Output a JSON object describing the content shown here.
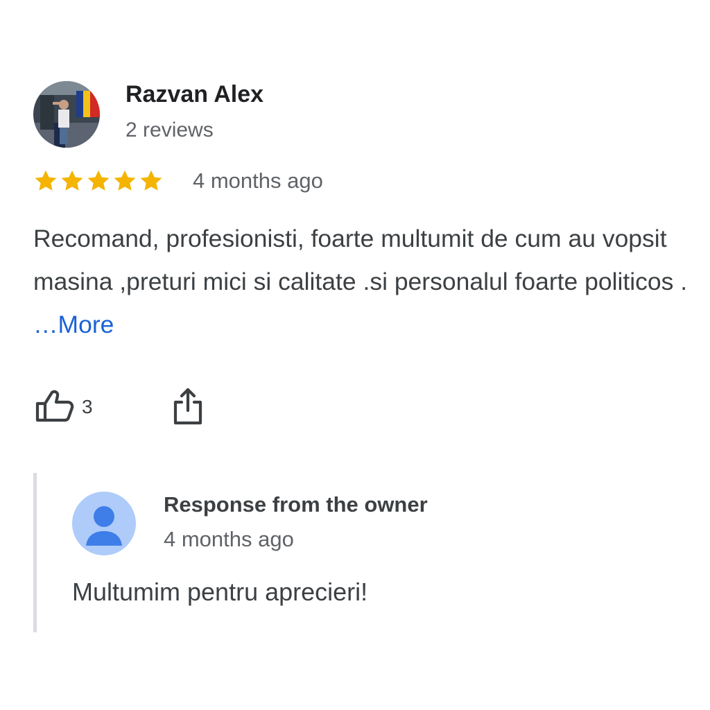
{
  "review": {
    "reviewer_name": "Razvan Alex",
    "reviewer_reviews": "2 reviews",
    "rating": 5,
    "rating_max": 5,
    "date": "4 months ago",
    "text": "Recomand, profesionisti, foarte multumit de cum au vopsit masina ,preturi mici si calitate .si personalul foarte politicos . ",
    "more_label": "…More",
    "like_count": "3",
    "icons": {
      "like": "thumbs-up-icon",
      "share": "share-icon",
      "star": "star-icon"
    }
  },
  "owner_response": {
    "title": "Response from the owner",
    "date": "4 months ago",
    "text": "Multumim pentru aprecieri!",
    "icon": "default-avatar-icon"
  },
  "colors": {
    "star": "#f4b400",
    "link": "#1a62d6",
    "owner_avatar_bg": "#aecbfa",
    "owner_avatar_fg": "#3f7ee8",
    "divider": "#dadce0"
  }
}
